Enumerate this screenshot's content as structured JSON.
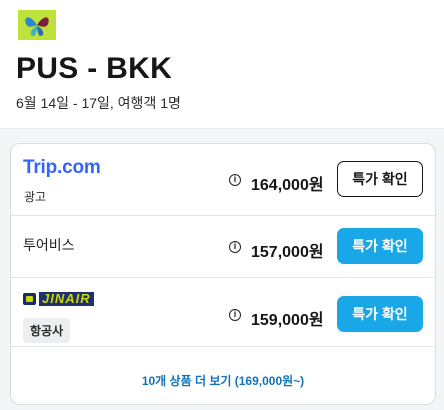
{
  "header": {
    "route": "PUS - BKK",
    "subtitle": "6월 14일 - 17일, 여행객 1명",
    "logo_icon": "butterfly-logo-icon"
  },
  "offers": [
    {
      "provider": "Trip.com",
      "tag": "광고",
      "price": "164,000원",
      "button_label": "특가 확인",
      "button_style": "outline"
    },
    {
      "provider": "투어비스",
      "price": "157,000원",
      "button_label": "특가 확인",
      "button_style": "primary"
    },
    {
      "provider": "JINAIR",
      "tag": "항공사",
      "price": "159,000원",
      "button_label": "특가 확인",
      "button_style": "primary"
    }
  ],
  "more_link": "10개 상품 더 보기 (169,000원~)",
  "colors": {
    "primary_button": "#1aa7e8",
    "link": "#1473b8",
    "trip_brand": "#3264ff",
    "logo_bg": "#bfe23a"
  }
}
